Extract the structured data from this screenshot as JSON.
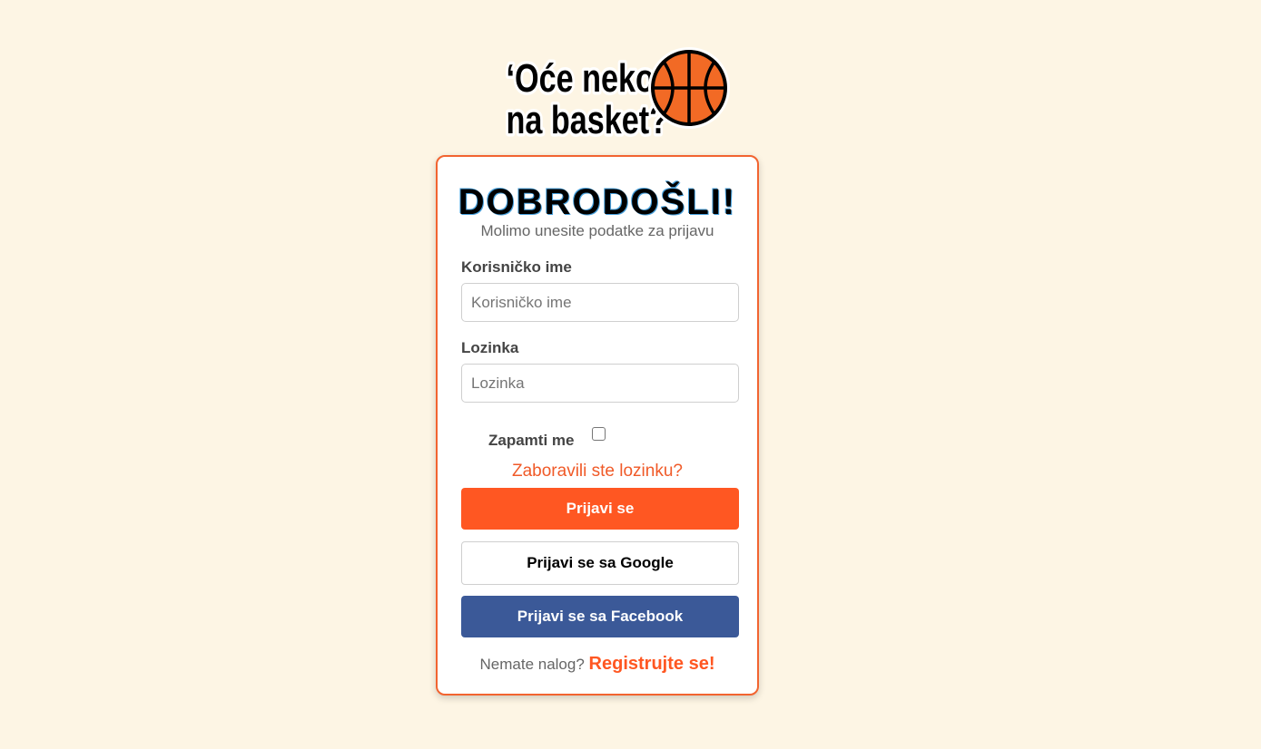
{
  "logo": {
    "line1": "‘Oće neko",
    "line2": "na basket?"
  },
  "card": {
    "title": "DOBRODOŠLI!",
    "subtitle": "Molimo unesite podatke za prijavu"
  },
  "form": {
    "username_label": "Korisničko ime",
    "username_placeholder": "Korisničko ime",
    "username_value": "",
    "password_label": "Lozinka",
    "password_placeholder": "Lozinka",
    "password_value": "",
    "remember_label": "Zapamti me",
    "remember_checked": false,
    "forgot_link": "Zaboravili ste lozinku?",
    "login_button": "Prijavi se",
    "google_button": "Prijavi se sa Google",
    "facebook_button": "Prijavi se sa Facebook",
    "no_account_text": "Nemate nalog?",
    "register_link": "Registrujte se!"
  },
  "colors": {
    "background": "#fdf5e4",
    "accent": "#ff5722",
    "facebook": "#3b5998",
    "card_border": "#f26430"
  }
}
